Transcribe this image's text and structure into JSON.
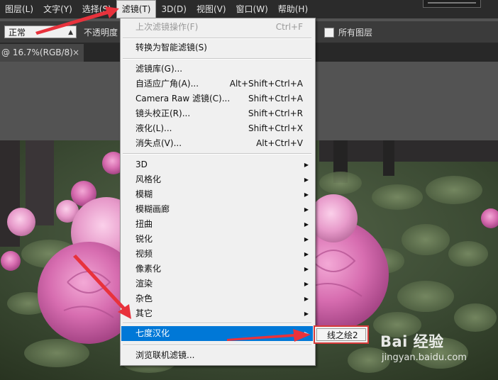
{
  "menubar": {
    "items": [
      {
        "label": "图层(L)"
      },
      {
        "label": "文字(Y)"
      },
      {
        "label": "选择(S)"
      },
      {
        "label": "滤镜(T)",
        "active": true
      },
      {
        "label": "3D(D)"
      },
      {
        "label": "视图(V)"
      },
      {
        "label": "窗口(W)"
      },
      {
        "label": "帮助(H)"
      }
    ]
  },
  "options": {
    "blend_mode": "正常",
    "opacity_label": "不透明度",
    "all_layers_label": "所有图层"
  },
  "document": {
    "tab_label": "@ 16.7%(RGB/8)",
    "close_glyph": "×"
  },
  "filter_menu": {
    "items": [
      {
        "label": "上次滤镜操作(F)",
        "shortcut": "Ctrl+F",
        "disabled": true
      },
      {
        "label": "转换为智能滤镜(S)"
      },
      {
        "label": "滤镜库(G)..."
      },
      {
        "label": "自适应广角(A)...",
        "shortcut": "Alt+Shift+Ctrl+A"
      },
      {
        "label": "Camera Raw 滤镜(C)...",
        "shortcut": "Shift+Ctrl+A"
      },
      {
        "label": "镜头校正(R)...",
        "shortcut": "Shift+Ctrl+R"
      },
      {
        "label": "液化(L)...",
        "shortcut": "Shift+Ctrl+X"
      },
      {
        "label": "消失点(V)...",
        "shortcut": "Alt+Ctrl+V"
      },
      {
        "label": "3D",
        "submenu": true
      },
      {
        "label": "风格化",
        "submenu": true
      },
      {
        "label": "模糊",
        "submenu": true
      },
      {
        "label": "模糊画廊",
        "submenu": true
      },
      {
        "label": "扭曲",
        "submenu": true
      },
      {
        "label": "锐化",
        "submenu": true
      },
      {
        "label": "视频",
        "submenu": true
      },
      {
        "label": "像素化",
        "submenu": true
      },
      {
        "label": "渲染",
        "submenu": true
      },
      {
        "label": "杂色",
        "submenu": true
      },
      {
        "label": "其它",
        "submenu": true
      },
      {
        "label": "七度汉化",
        "submenu": true,
        "highlighted": true
      },
      {
        "label": "浏览联机滤镜..."
      }
    ]
  },
  "submenu": {
    "item": "线之绘2"
  },
  "watermark": {
    "brand": "Bai 经验",
    "url": "jingyan.baidu.com"
  },
  "colors": {
    "menu_highlight": "#0078d7",
    "annotation_red": "#e8323c"
  }
}
